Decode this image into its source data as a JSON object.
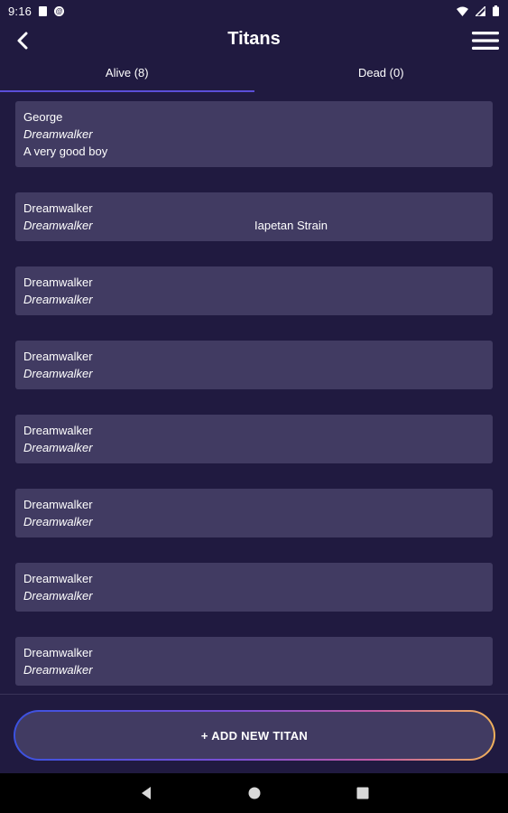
{
  "status_bar": {
    "time": "9:16"
  },
  "app_bar": {
    "title": "Titans"
  },
  "tabs": [
    {
      "label": "Alive (8)",
      "active": true
    },
    {
      "label": "Dead (0)",
      "active": false
    }
  ],
  "titans": [
    {
      "name": "George",
      "species": "Dreamwalker",
      "description": "A very good boy",
      "strain": ""
    },
    {
      "name": "Dreamwalker",
      "species": "Dreamwalker",
      "description": "",
      "strain": "Iapetan Strain"
    },
    {
      "name": "Dreamwalker",
      "species": "Dreamwalker",
      "description": "",
      "strain": ""
    },
    {
      "name": "Dreamwalker",
      "species": "Dreamwalker",
      "description": "",
      "strain": ""
    },
    {
      "name": "Dreamwalker",
      "species": "Dreamwalker",
      "description": "",
      "strain": ""
    },
    {
      "name": "Dreamwalker",
      "species": "Dreamwalker",
      "description": "",
      "strain": ""
    },
    {
      "name": "Dreamwalker",
      "species": "Dreamwalker",
      "description": "",
      "strain": ""
    },
    {
      "name": "Dreamwalker",
      "species": "Dreamwalker",
      "description": "",
      "strain": ""
    }
  ],
  "add_button": {
    "label": "+ ADD NEW TITAN"
  },
  "icons": {
    "back": "back-arrow-icon",
    "menu": "hamburger-menu-icon",
    "nav_back": "nav-back-triangle-icon",
    "nav_home": "nav-home-circle-icon",
    "nav_recent": "nav-recents-square-icon"
  }
}
